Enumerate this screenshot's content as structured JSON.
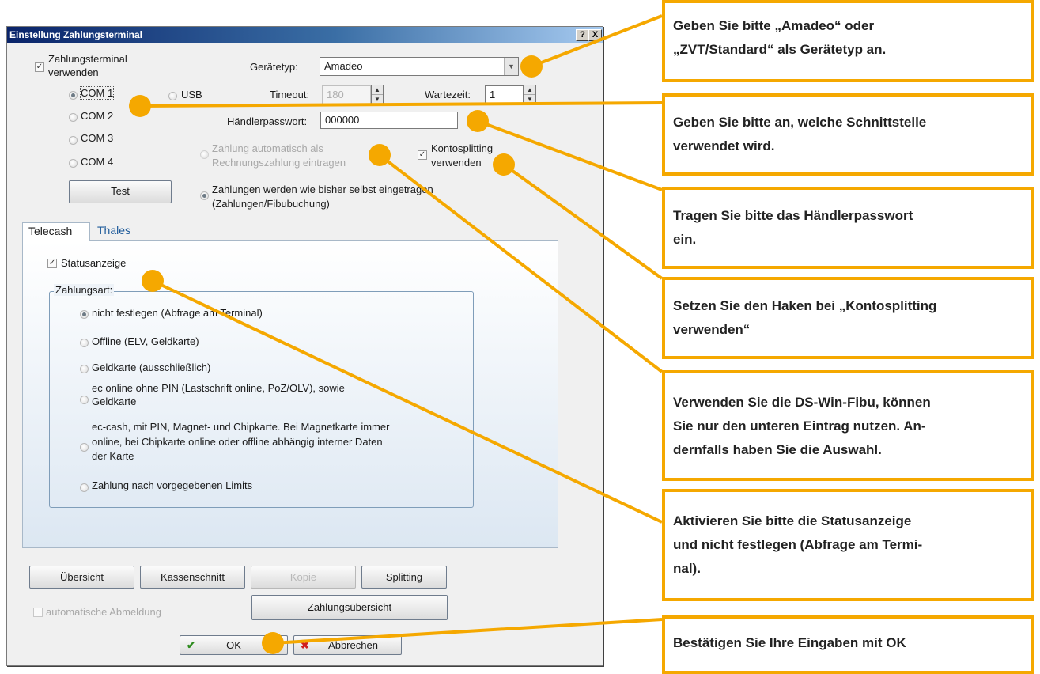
{
  "window": {
    "title": "Einstellung Zahlungsterminal",
    "help_btn": "?",
    "close_btn": "X"
  },
  "top": {
    "use_terminal_line1": "Zahlungsterminal",
    "use_terminal_line2": "verwenden",
    "device_type_label": "Gerätetyp:",
    "device_type_value": "Amadeo",
    "timeout_label": "Timeout:",
    "timeout_value": "180",
    "wait_label": "Wartezeit:",
    "wait_value": "1",
    "merchant_pw_label": "Händlerpasswort:",
    "merchant_pw_value": "000000",
    "ports": [
      "COM 1",
      "COM 2",
      "COM 3",
      "COM 4"
    ],
    "usb": "USB",
    "test_button": "Test",
    "auto_payment_line1": "Zahlung automatisch als",
    "auto_payment_line2": "Rechnungszahlung eintragen",
    "splitting_line1": "Kontosplitting",
    "splitting_line2": "verwenden",
    "manual_payment_line1": "Zahlungen werden wie bisher selbst eingetragen",
    "manual_payment_line2": "(Zahlungen/Fibubuchung)"
  },
  "tabs": [
    "Telecash",
    "Thales"
  ],
  "telecash": {
    "status_display": "Statusanzeige",
    "group_title": "Zahlungsart:",
    "options": [
      {
        "lines": [
          "nicht festlegen (Abfrage am Terminal)"
        ]
      },
      {
        "lines": [
          "Offline (ELV, Geldkarte)"
        ]
      },
      {
        "lines": [
          "Geldkarte (ausschließlich)"
        ]
      },
      {
        "lines": [
          "ec online ohne PIN (Lastschrift online, PoZ/OLV), sowie",
          "Geldkarte"
        ]
      },
      {
        "lines": [
          "ec-cash, mit PIN, Magnet- und Chipkarte. Bei Magnetkarte immer",
          "online, bei Chipkarte online oder offline abhängig interner Daten",
          "der Karte"
        ]
      },
      {
        "lines": [
          "Zahlung nach vorgegebenen Limits"
        ]
      }
    ]
  },
  "bottom": {
    "overview": "Übersicht",
    "cash_cut": "Kassenschnitt",
    "copy": "Kopie",
    "splitting": "Splitting",
    "auto_logout": "automatische Abmeldung",
    "payment_overview": "Zahlungsübersicht",
    "ok": "OK",
    "cancel": "Abbrechen"
  },
  "callouts": [
    {
      "lines": [
        "Geben Sie bitte „Amadeo“ oder",
        "„ZVT/Standard“ als Gerätetyp an."
      ]
    },
    {
      "lines": [
        "Geben Sie bitte an, welche Schnittstelle",
        "verwendet wird."
      ]
    },
    {
      "lines": [
        "Tragen Sie bitte das Händlerpasswort",
        "ein."
      ]
    },
    {
      "lines": [
        "Setzen Sie den Haken bei „Kontosplitting",
        "verwenden“"
      ]
    },
    {
      "lines": [
        "Verwenden Sie die DS-Win-Fibu, können",
        "Sie nur den unteren Eintrag nutzen. An-",
        "dernfalls haben Sie die Auswahl."
      ]
    },
    {
      "lines": [
        "Aktivieren Sie bitte die Statusanzeige",
        "und nicht festlegen (Abfrage am Termi-",
        "nal)."
      ]
    },
    {
      "lines": [
        "Bestätigen Sie Ihre Eingaben mit OK"
      ]
    }
  ],
  "colors": {
    "accent": "#f5a800",
    "titlebar": "#0a246a",
    "tab_link": "#1d5a9a"
  }
}
